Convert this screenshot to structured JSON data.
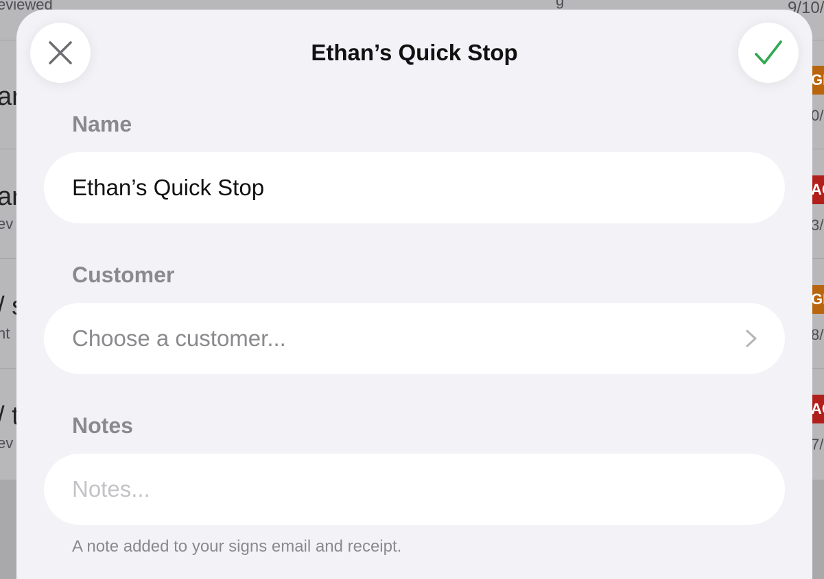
{
  "background": {
    "top_sub": "eviewed",
    "top_center_fragment": "g",
    "top_date": "9/10/",
    "rows": [
      {
        "title": "ar",
        "sub": "",
        "badge": "GN",
        "badge_color": "#b8650d",
        "date": "0/"
      },
      {
        "title": "ar",
        "sub": "ev",
        "badge": "AC",
        "badge_color": "#b01f1a",
        "date": "3/"
      },
      {
        "title": "/ s",
        "sub": "nt",
        "badge": "GN",
        "badge_color": "#b8650d",
        "date": "8/"
      },
      {
        "title": "/ t",
        "sub": "ev",
        "badge": "AC",
        "badge_color": "#b01f1a",
        "date": "7/"
      }
    ]
  },
  "modal": {
    "title": "Ethan’s Quick Stop",
    "close_icon": "close-icon",
    "confirm_icon": "checkmark-icon",
    "accent_color": "#34a853",
    "name": {
      "label": "Name",
      "value": "Ethan’s Quick Stop"
    },
    "customer": {
      "label": "Customer",
      "placeholder": "Choose a customer..."
    },
    "notes": {
      "label": "Notes",
      "placeholder": "Notes...",
      "hint": "A note added to your signs email and receipt."
    }
  }
}
